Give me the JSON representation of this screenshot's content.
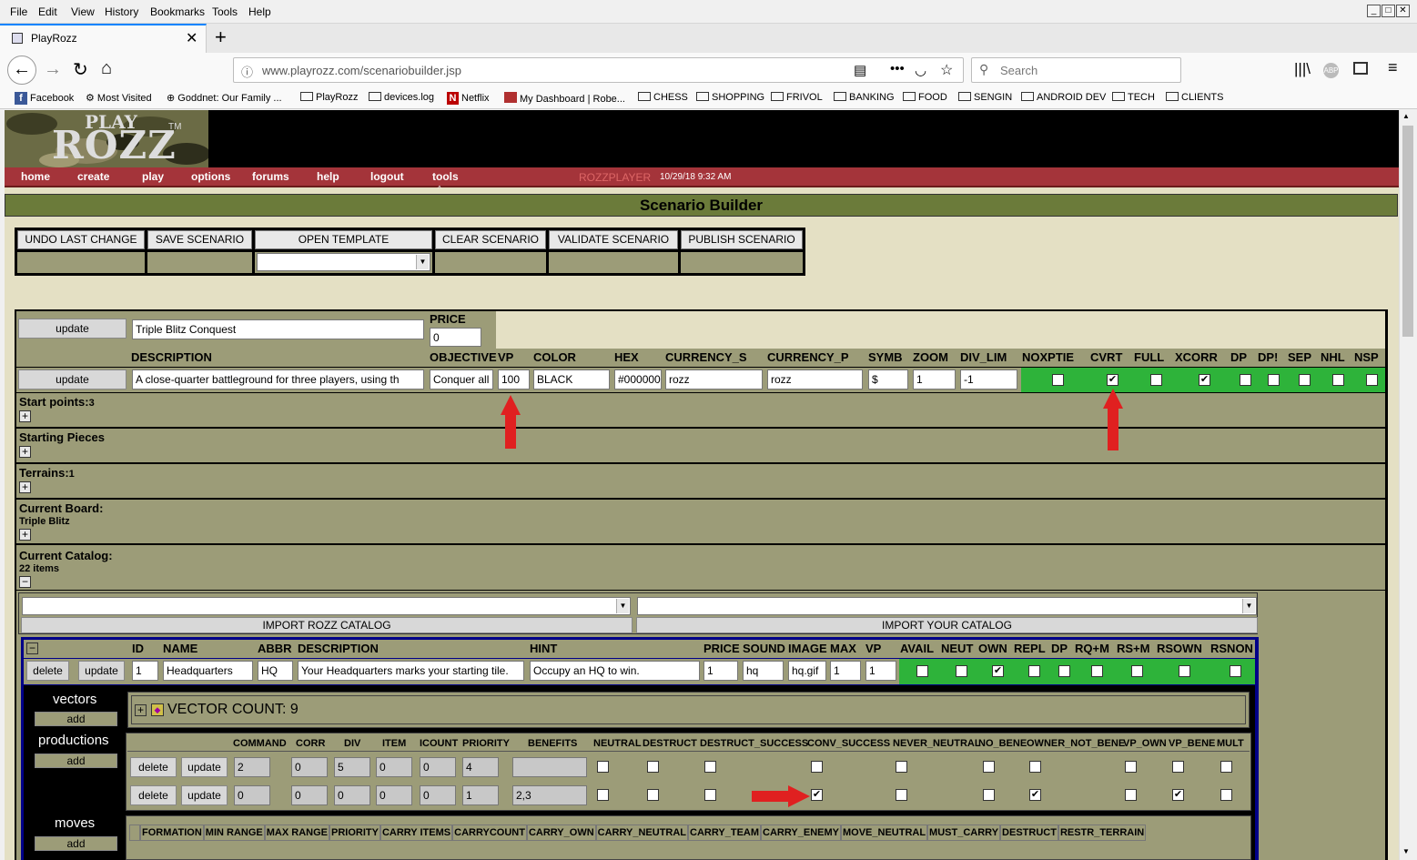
{
  "browser": {
    "menu": [
      "File",
      "Edit",
      "View",
      "History",
      "Bookmarks",
      "Tools",
      "Help"
    ],
    "tab_title": "PlayRozz",
    "url": "www.playrozz.com/scenariobuilder.jsp",
    "search_placeholder": "Search",
    "bookmarks": [
      "Facebook",
      "Most Visited",
      "Goddnet: Our Family ...",
      "PlayRozz",
      "devices.log",
      "Netflix",
      "My Dashboard | Robe...",
      "CHESS",
      "SHOPPING",
      "FRIVOL",
      "BANKING",
      "FOOD",
      "SENGIN",
      "ANDROID DEV",
      "TECH",
      "CLIENTS"
    ]
  },
  "site": {
    "logo_top": "PLAY",
    "logo_main": "ROZZ",
    "logo_tm": "TM",
    "nav": [
      "home",
      "create",
      "play",
      "options",
      "forums",
      "help",
      "logout",
      "tools"
    ],
    "user": "ROZZPLAYER",
    "datetime": "10/29/18 9:32 AM",
    "page_title": "Scenario Builder"
  },
  "toolbar": [
    "UNDO LAST CHANGE",
    "SAVE SCENARIO",
    "OPEN TEMPLATE",
    "CLEAR SCENARIO",
    "VALIDATE SCENARIO",
    "PUBLISH SCENARIO"
  ],
  "scenario": {
    "update": "update",
    "name": "Triple Blitz Conquest",
    "price_label": "PRICE",
    "price": "0",
    "headers": [
      "DESCRIPTION",
      "OBJECTIVE",
      "VP",
      "COLOR",
      "HEX",
      "CURRENCY_S",
      "CURRENCY_P",
      "SYMB",
      "ZOOM",
      "DIV_LIM",
      "NOXPTIE",
      "CVRT",
      "FULL",
      "XCORR",
      "DP",
      "DP!",
      "SEP",
      "NHL",
      "NSP"
    ],
    "description": "A close-quarter battleground for three players, using th",
    "objective": "Conquer all",
    "vp": "100",
    "color": "BLACK",
    "hex": "#000000",
    "currency_s": "rozz",
    "currency_p": "rozz",
    "symb": "$",
    "zoom": "1",
    "div_lim": "-1",
    "flags": [
      false,
      true,
      false,
      true,
      false,
      false,
      false,
      false,
      false
    ]
  },
  "sections": {
    "start_points": "Start points:",
    "start_points_count": "3",
    "starting_pieces": "Starting Pieces",
    "terrains": "Terrains:",
    "terrains_count": "1",
    "current_board": "Current Board:",
    "board_name": "Triple Blitz",
    "current_catalog": "Current Catalog:",
    "catalog_count": "22 items"
  },
  "catalog": {
    "import_rozz": "IMPORT ROZZ CATALOG",
    "import_yours": "IMPORT YOUR CATALOG",
    "headers": [
      "ID",
      "NAME",
      "ABBR",
      "DESCRIPTION",
      "HINT",
      "PRICE",
      "SOUND",
      "IMAGE",
      "MAX",
      "VP",
      "AVAIL",
      "NEUT",
      "OWN",
      "REPL",
      "DP",
      "RQ+M",
      "RS+M",
      "RSOWN",
      "RSNON"
    ],
    "delete": "delete",
    "update": "update",
    "id": "1",
    "name": "Headquarters",
    "abbr": "HQ",
    "description": "Your Headquarters marks your starting tile.",
    "hint": "Occupy an HQ to win.",
    "price": "1",
    "sound": "hq",
    "image": "hq.gif",
    "max": "1",
    "vp": "1",
    "flags": [
      false,
      false,
      true,
      false,
      false,
      false,
      false,
      false,
      false
    ]
  },
  "vectors": {
    "label": "vectors",
    "add": "add",
    "count": "VECTOR COUNT: 9"
  },
  "productions": {
    "label": "productions",
    "add": "add",
    "headers": [
      "COMMAND",
      "CORR",
      "DIV",
      "ITEM",
      "ICOUNT",
      "PRIORITY",
      "BENEFITS",
      "NEUTRAL",
      "DESTRUCT",
      "DESTRUCT_SUCCESS",
      "CONV_SUCCESS",
      "NEVER_NEUTRAL",
      "NO_BENE",
      "OWNER_NOT_BENE",
      "VP_OWN",
      "VP_BENE",
      "MULT"
    ],
    "rows": [
      {
        "command": "2",
        "corr": "0",
        "div": "5",
        "item": "0",
        "icount": "0",
        "priority": "4",
        "benefits": "",
        "flags": [
          false,
          false,
          false,
          false,
          false,
          false,
          false,
          false,
          false,
          false
        ]
      },
      {
        "command": "0",
        "corr": "0",
        "div": "0",
        "item": "0",
        "icount": "0",
        "priority": "1",
        "benefits": "2,3",
        "flags": [
          false,
          false,
          false,
          true,
          false,
          false,
          true,
          false,
          true,
          false
        ]
      }
    ]
  },
  "moves": {
    "label": "moves",
    "add": "add",
    "headers": [
      "FORMATION",
      "MIN RANGE",
      "MAX RANGE",
      "PRIORITY",
      "CARRY ITEMS",
      "CARRYCOUNT",
      "CARRY_OWN",
      "CARRY_NEUTRAL",
      "CARRY_TEAM",
      "CARRY_ENEMY",
      "MOVE_NEUTRAL",
      "MUST_CARRY",
      "DESTRUCT",
      "RESTR_TERRAIN"
    ]
  },
  "colors": {
    "page_bg": "#e4e0c4",
    "olive": "#9c9c78",
    "green": "#2eb33a",
    "title_bar": "#6b7b3a",
    "nav_red": "#a4343a",
    "annotation_red": "#e02020"
  }
}
